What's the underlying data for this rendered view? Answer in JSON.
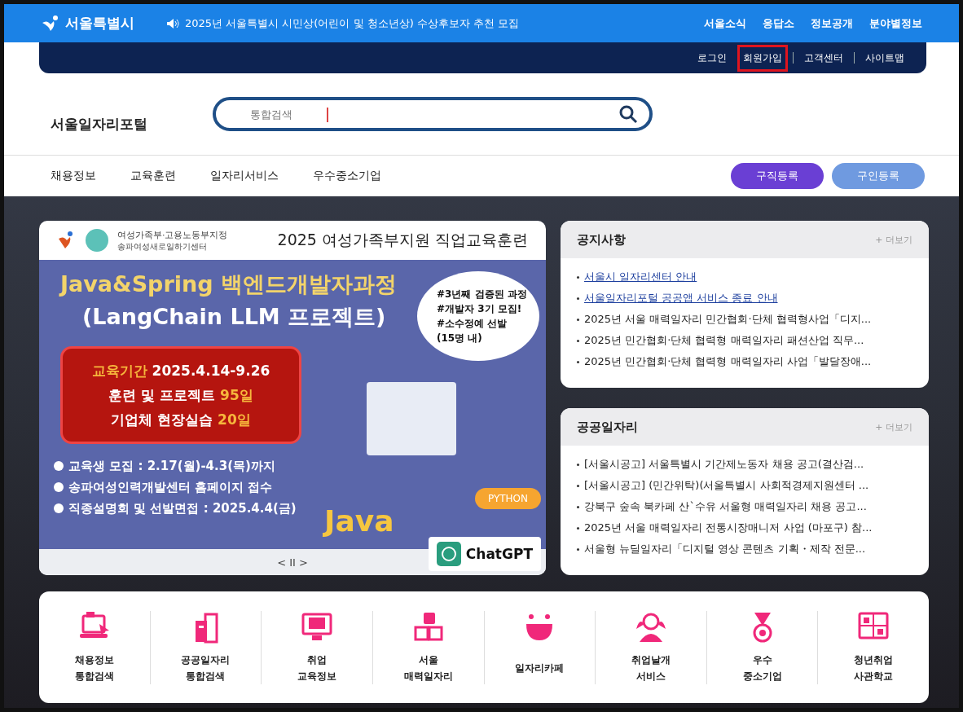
{
  "top_bar": {
    "logo": "서울특별시",
    "announcement": "2025년 서울특별시 시민상(어린이 및 청소년상) 수상후보자 추천 모집",
    "links": [
      "서울소식",
      "응답소",
      "정보공개",
      "분야별정보"
    ]
  },
  "util_bar": {
    "links": [
      {
        "label": "로그인",
        "highlighted": false
      },
      {
        "label": "회원가입",
        "highlighted": true
      },
      {
        "label": "고객센터",
        "highlighted": false
      },
      {
        "label": "사이트맵",
        "highlighted": false
      }
    ]
  },
  "header": {
    "site_title": "서울일자리포털",
    "search": {
      "placeholder": "통합검색"
    }
  },
  "nav": {
    "items": [
      "채용정보",
      "교육훈련",
      "일자리서비스",
      "우수중소기업"
    ],
    "buttons": [
      {
        "label": "구직등록",
        "kind": "primary"
      },
      {
        "label": "구인등록",
        "kind": "secondary"
      }
    ]
  },
  "banner": {
    "org_small": "여성가족부·고용노동부지정",
    "org": "송파여성새로일하기센터",
    "headline": "2025 여성가족부지원 직업교육훈련",
    "title_1": "Java&Spring 백엔드개발자과정",
    "title_2": "(LangChain LLM 프로젝트)",
    "period_lines": [
      "**교육기간** 2025.4.14-9.26",
      "훈련 및 프로젝트 **95일**",
      "기업체 현장실습 **20일**"
    ],
    "bullets": [
      "교육생 모집 : 2.17(월)-4.3(목)까지",
      "송파여성인력개발센터 홈페이지 접수",
      "직종설명회 및 선발면접 : 2025.4.4(금)"
    ],
    "bubble": [
      "#3년째 검증된 과정",
      "#개발자 3기 모집!",
      "#소수정예 선발",
      "(15명 내)"
    ],
    "tag_python": "PYTHON",
    "tag_java": "Java",
    "tag_chatgpt": "ChatGPT",
    "controls": "< II >"
  },
  "notices": {
    "title": "공지사항",
    "more": "+ 더보기",
    "items": [
      {
        "text": "서울시 일자리센터 안내",
        "link": true
      },
      {
        "text": "서울일자리포털 공공앱 서비스 종료 안내",
        "link": true
      },
      {
        "text": "2025년 서울 매력일자리 민간협회·단체 협력형사업「디지...",
        "link": false
      },
      {
        "text": "2025년 민간협회·단체 협력형 매력일자리 패션산업 직무...",
        "link": false
      },
      {
        "text": "2025년 민간협회·단체 협력형 매력일자리 사업「발달장애...",
        "link": false
      }
    ]
  },
  "public_jobs": {
    "title": "공공일자리",
    "more": "+ 더보기",
    "items": [
      "[서울시공고] 서울특별시 기간제노동자 채용 공고(결산검...",
      "[서울시공고] (민간위탁)(서울특별시 사회적경제지원센터 ...",
      "강북구 숲속 북카페 산`수유 서울형 매력일자리 채용 공고...",
      "2025년 서울 매력일자리 전통시장매니저 사업 (마포구) 참...",
      "서울형 뉴딜일자리「디지털 영상 콘텐츠 기획・제작 전문..."
    ]
  },
  "quick_menu": [
    {
      "kind": "laptop",
      "lines": [
        "채용정보",
        "통합검색"
      ]
    },
    {
      "kind": "building",
      "lines": [
        "공공일자리",
        "통합검색"
      ]
    },
    {
      "kind": "monitor",
      "lines": [
        "취업",
        "교육정보"
      ]
    },
    {
      "kind": "blocks",
      "lines": [
        "서울",
        "매력일자리"
      ]
    },
    {
      "kind": "bowl",
      "lines": [
        "일자리카페"
      ]
    },
    {
      "kind": "person",
      "lines": [
        "취업날개",
        "서비스"
      ]
    },
    {
      "kind": "medal",
      "lines": [
        "우수",
        "중소기업"
      ]
    },
    {
      "kind": "video",
      "lines": [
        "청년취업",
        "사관학교"
      ]
    }
  ]
}
